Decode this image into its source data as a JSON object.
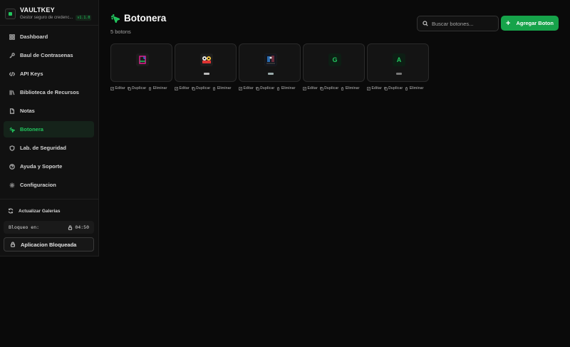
{
  "brand": {
    "name": "VAULTKEY",
    "subtitle": "Gestor seguro de credenc...",
    "version": "v1.1.0"
  },
  "sidebar": {
    "items": [
      {
        "label": "Dashboard",
        "icon": "grid-icon",
        "active": false
      },
      {
        "label": "Baul de Contrasenas",
        "icon": "key-icon",
        "active": false
      },
      {
        "label": "API Keys",
        "icon": "code-icon",
        "active": false
      },
      {
        "label": "Biblioteca de Recursos",
        "icon": "library-icon",
        "active": false
      },
      {
        "label": "Notas",
        "icon": "note-icon",
        "active": false
      },
      {
        "label": "Botonera",
        "icon": "click-icon",
        "active": true
      },
      {
        "label": "Lab. de Seguridad",
        "icon": "shield-icon",
        "active": false
      },
      {
        "label": "Ayuda y Soporte",
        "icon": "help-icon",
        "active": false
      },
      {
        "label": "Configuracion",
        "icon": "gear-icon",
        "active": false
      }
    ],
    "refresh_label": "Actualizar Galerias",
    "lock_label": "Bloqueo en:",
    "lock_time": "04:50",
    "locked_button": "Aplicacion Bloqueada"
  },
  "header": {
    "title": "Botonera",
    "count": "5 botons",
    "search_placeholder": "Buscar botones...",
    "add_label": "Agregar Boton",
    "accent": "#22c55e"
  },
  "actions": {
    "edit": "Editar",
    "duplicate": "Duplicar",
    "delete": "Eliminar"
  },
  "buttons": [
    {
      "thumb": "",
      "type": "image"
    },
    {
      "thumb": "",
      "type": "image"
    },
    {
      "thumb": "",
      "type": "image"
    },
    {
      "thumb": "G",
      "type": "letter"
    },
    {
      "thumb": "A",
      "type": "letter"
    }
  ]
}
